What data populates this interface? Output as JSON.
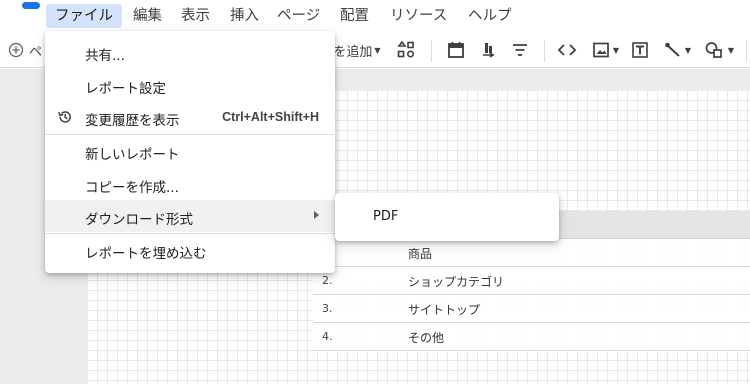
{
  "menubar": {
    "items": [
      "ファイル",
      "編集",
      "表示",
      "挿入",
      "ページ",
      "配置",
      "リソース",
      "ヘルプ"
    ],
    "active_index": 0
  },
  "toolbar": {
    "add_page_label": "ペ",
    "add_data_label": "を追加",
    "icons": [
      "add-circle-icon",
      "component-icon",
      "calendar-icon",
      "sort-icon",
      "filter-icon",
      "code-icon",
      "image-icon",
      "text-icon",
      "line-icon",
      "shape-icon"
    ]
  },
  "file_menu": {
    "items": [
      {
        "label": "共有..."
      },
      {
        "label": "レポート設定"
      },
      {
        "label": "変更履歴を表示",
        "icon": "history-icon",
        "shortcut": "Ctrl+Alt+Shift+H"
      },
      {
        "label": "新しいレポート"
      },
      {
        "label": "コピーを作成..."
      },
      {
        "label": "ダウンロード形式",
        "has_submenu": true
      },
      {
        "label": "レポートを埋め込む"
      }
    ]
  },
  "download_submenu": {
    "items": [
      "PDF"
    ]
  },
  "table": {
    "rows": [
      {
        "num": "",
        "value": "商品"
      },
      {
        "num": "2.",
        "value": "ショップカテゴリ"
      },
      {
        "num": "3.",
        "value": "サイトトップ"
      },
      {
        "num": "4.",
        "value": "その他"
      }
    ]
  },
  "colors": {
    "accent": "#1a73e8",
    "menu_active_bg": "#d2e3fc",
    "menu_hover_bg": "#f1f1f1",
    "canvas_bg": "#ececec"
  }
}
